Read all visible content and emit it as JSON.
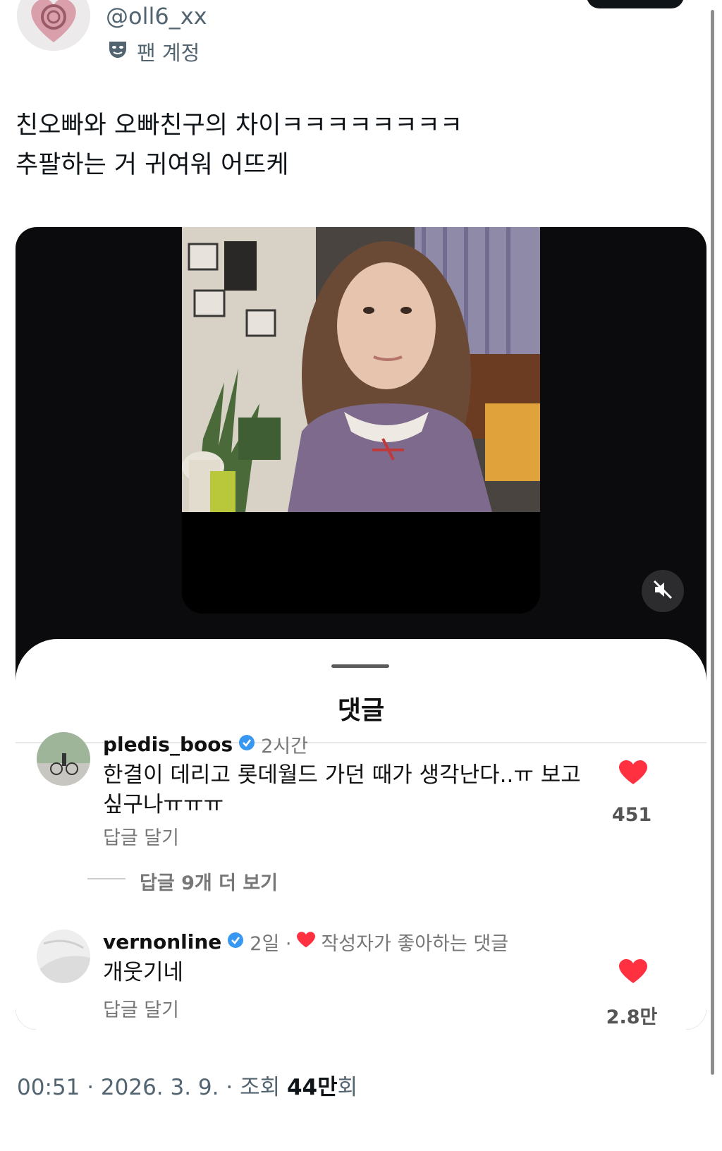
{
  "header": {
    "username": "@oll6_xx",
    "badge_label": "팬 계정",
    "badge_icon": "mask-icon"
  },
  "post": {
    "lines": [
      "친오빠와 오빠친구의 차이ㅋㅋㅋㅋㅋㅋㅋㅋ",
      "추팔하는 거 귀여워 어뜨케"
    ]
  },
  "comments_sheet": {
    "title": "댓글",
    "comments": [
      {
        "user": "pledis_boos",
        "verified": true,
        "time": "2시간",
        "text_line1": "한결이 데리고 롯데월드 가던 때가 생각난다..ㅠ 보고",
        "text_line2": "싶구나ㅠㅠㅠ",
        "reply_label": "답글 달기",
        "likes": "451",
        "more_replies": "답글 9개 더 보기"
      },
      {
        "user": "vernonline",
        "verified": true,
        "time": "2일 ·",
        "liked_by_author": "작성자가 좋아하는 댓글",
        "text_line1": "개웃기네",
        "reply_label": "답글 달기",
        "likes": "2.8만"
      }
    ]
  },
  "footer": {
    "prefix": "00:51 · 2026. 3. 9. · 조회 ",
    "views": "44만",
    "suffix": "회"
  },
  "colors": {
    "verified": "#3897f0",
    "heart": "#ff3040",
    "muted_text": "#536471"
  }
}
